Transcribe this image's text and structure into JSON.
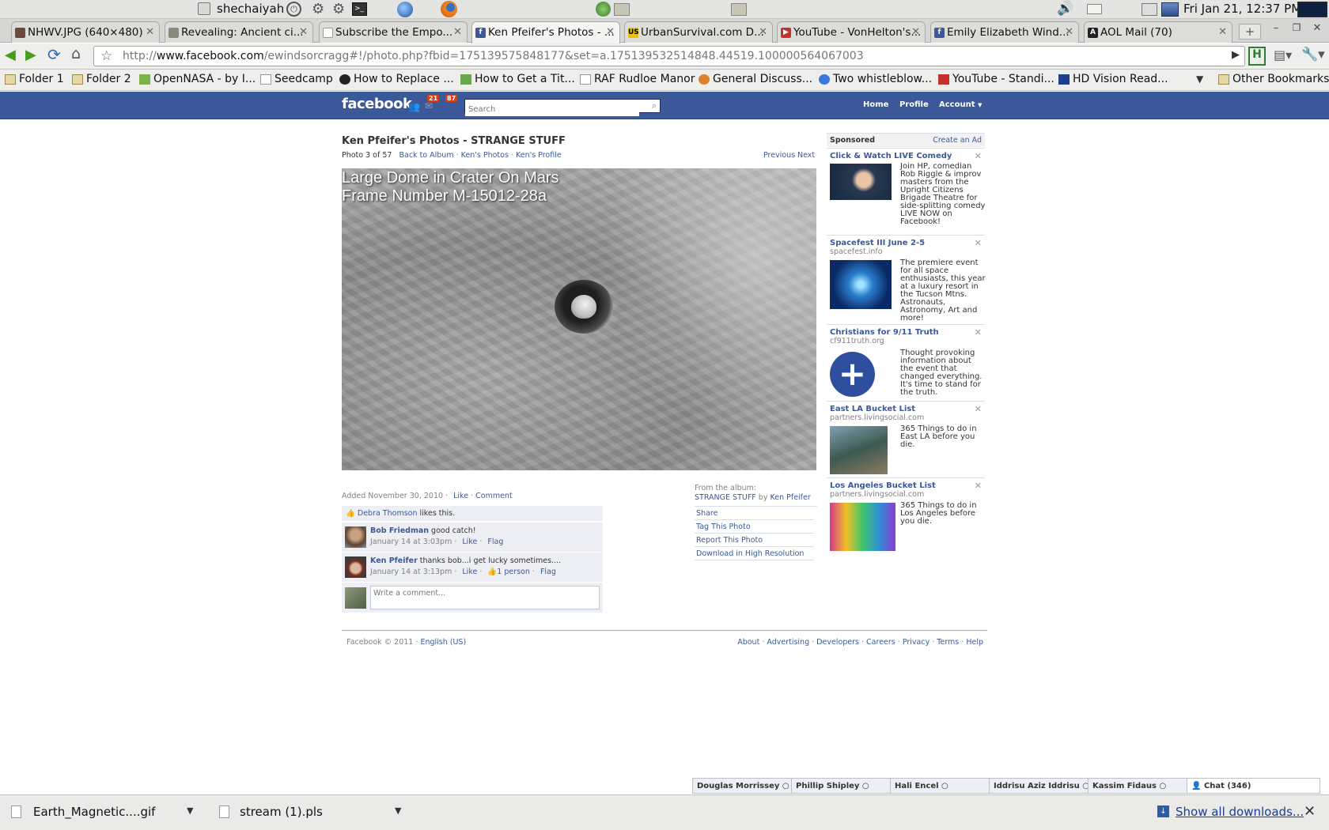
{
  "system_bar": {
    "user": "shechaiyah",
    "datetime": "Fri Jan 21, 12:37 PM"
  },
  "tabs": [
    {
      "label": "NHWV.JPG (640×480)",
      "icon": "image-icon"
    },
    {
      "label": "Revealing: Ancient ci...",
      "icon": "page-icon"
    },
    {
      "label": "Subscribe the Empo...",
      "icon": "document-icon"
    },
    {
      "label": "Ken Pfeifer's Photos - ...",
      "icon": "facebook-icon"
    },
    {
      "label": "UrbanSurvival.com D...",
      "icon": "us-icon"
    },
    {
      "label": "YouTube - VonHelton's...",
      "icon": "youtube-icon"
    },
    {
      "label": "Emily Elizabeth Wind...",
      "icon": "facebook-icon"
    },
    {
      "label": "AOL Mail (70)",
      "icon": "aol-icon"
    }
  ],
  "address": {
    "prefix": "http://",
    "domain": "www.facebook.com",
    "path": "/ewindsorcragg#!/photo.php?fbid=175139575848177&set=a.175139532514848.44519.100000564067003"
  },
  "bookmarks": [
    "Folder 1",
    "Folder 2",
    "OpenNASA - by I...",
    "Seedcamp",
    "How to Replace ...",
    "How to Get a Tit...",
    "RAF Rudloe Manor",
    "General Discuss...",
    "Two whistleblow...",
    "YouTube - Standi...",
    "HD Vision Read..."
  ],
  "other_bookmarks": "Other Bookmarks",
  "fb_header": {
    "logo": "facebook",
    "friend_requests": "21",
    "messages": "87",
    "search_placeholder": "Search",
    "nav": [
      "Home",
      "Profile",
      "Account"
    ]
  },
  "photo": {
    "title": "Ken Pfeifer's Photos - STRANGE STUFF",
    "counter": "Photo 3 of 57",
    "crumbs": [
      "Back to Album",
      "Ken's Photos",
      "Ken's Profile"
    ],
    "previous": "Previous",
    "next": "Next",
    "caption_line1": "Large Dome in Crater On Mars",
    "caption_line2": "Frame Number M-15012-28a",
    "added": "Added November 30, 2010",
    "like": "Like",
    "comment": "Comment"
  },
  "likes": {
    "name": "Debra Thomson",
    "text": "likes this."
  },
  "comments": [
    {
      "author": "Bob Friedman",
      "text": "good catch!",
      "time": "January 14 at 3:03pm",
      "like": "Like",
      "flag": "Flag",
      "likes_count": ""
    },
    {
      "author": "Ken Pfeifer",
      "text": "thanks bob...i get lucky sometimes....",
      "time": "January 14 at 3:13pm",
      "like": "Like",
      "flag": "Flag",
      "likes_count": "1 person"
    }
  ],
  "comment_box_placeholder": "Write a comment...",
  "album": {
    "from_label": "From the album:",
    "name": "STRANGE STUFF",
    "by": "by",
    "owner": "Ken Pfeifer",
    "actions": [
      "Share",
      "Tag This Photo",
      "Report This Photo",
      "Download in High Resolution"
    ]
  },
  "sponsored": {
    "heading": "Sponsored",
    "create_ad": "Create an Ad",
    "ads": [
      {
        "title": "Click & Watch LIVE Comedy",
        "url": "",
        "body": "Join HP, comedian Rob Riggle & improv masters from the Upright Citizens Brigade Theatre for side-splitting comedy LIVE NOW on Facebook!"
      },
      {
        "title": "Spacefest III June 2-5",
        "url": "spacefest.info",
        "body": "The premiere event for all space enthusiasts, this year at a luxury resort in the Tucson Mtns. Astronauts, Astronomy, Art and more!"
      },
      {
        "title": "Christians for 9/11 Truth",
        "url": "cf911truth.org",
        "body": "Thought provoking information about the event that changed everything. It's time to stand for the truth."
      },
      {
        "title": "East LA Bucket List",
        "url": "partners.livingsocial.com",
        "body": "365 Things to do in East LA before you die."
      },
      {
        "title": "Los Angeles Bucket List",
        "url": "partners.livingsocial.com",
        "body": "365 Things to do in Los Angeles before you die."
      }
    ]
  },
  "footer": {
    "copyright": "Facebook © 2011",
    "language": "English (US)",
    "links": [
      "About",
      "Advertising",
      "Developers",
      "Careers",
      "Privacy",
      "Terms",
      "Help"
    ]
  },
  "chat": {
    "people": [
      "Douglas Morrissey",
      "Phillip Shipley",
      "Hali Encel",
      "Iddrisu Aziz Iddrisu",
      "Kassim Fidaus"
    ],
    "chat_label": "Chat (346)"
  },
  "downloads": {
    "items": [
      "Earth_Magnetic....gif",
      "stream (1).pls"
    ],
    "show_all": "Show all downloads..."
  },
  "colors": {
    "fb_blue": "#3b5998",
    "fb_link": "#3b5998"
  }
}
